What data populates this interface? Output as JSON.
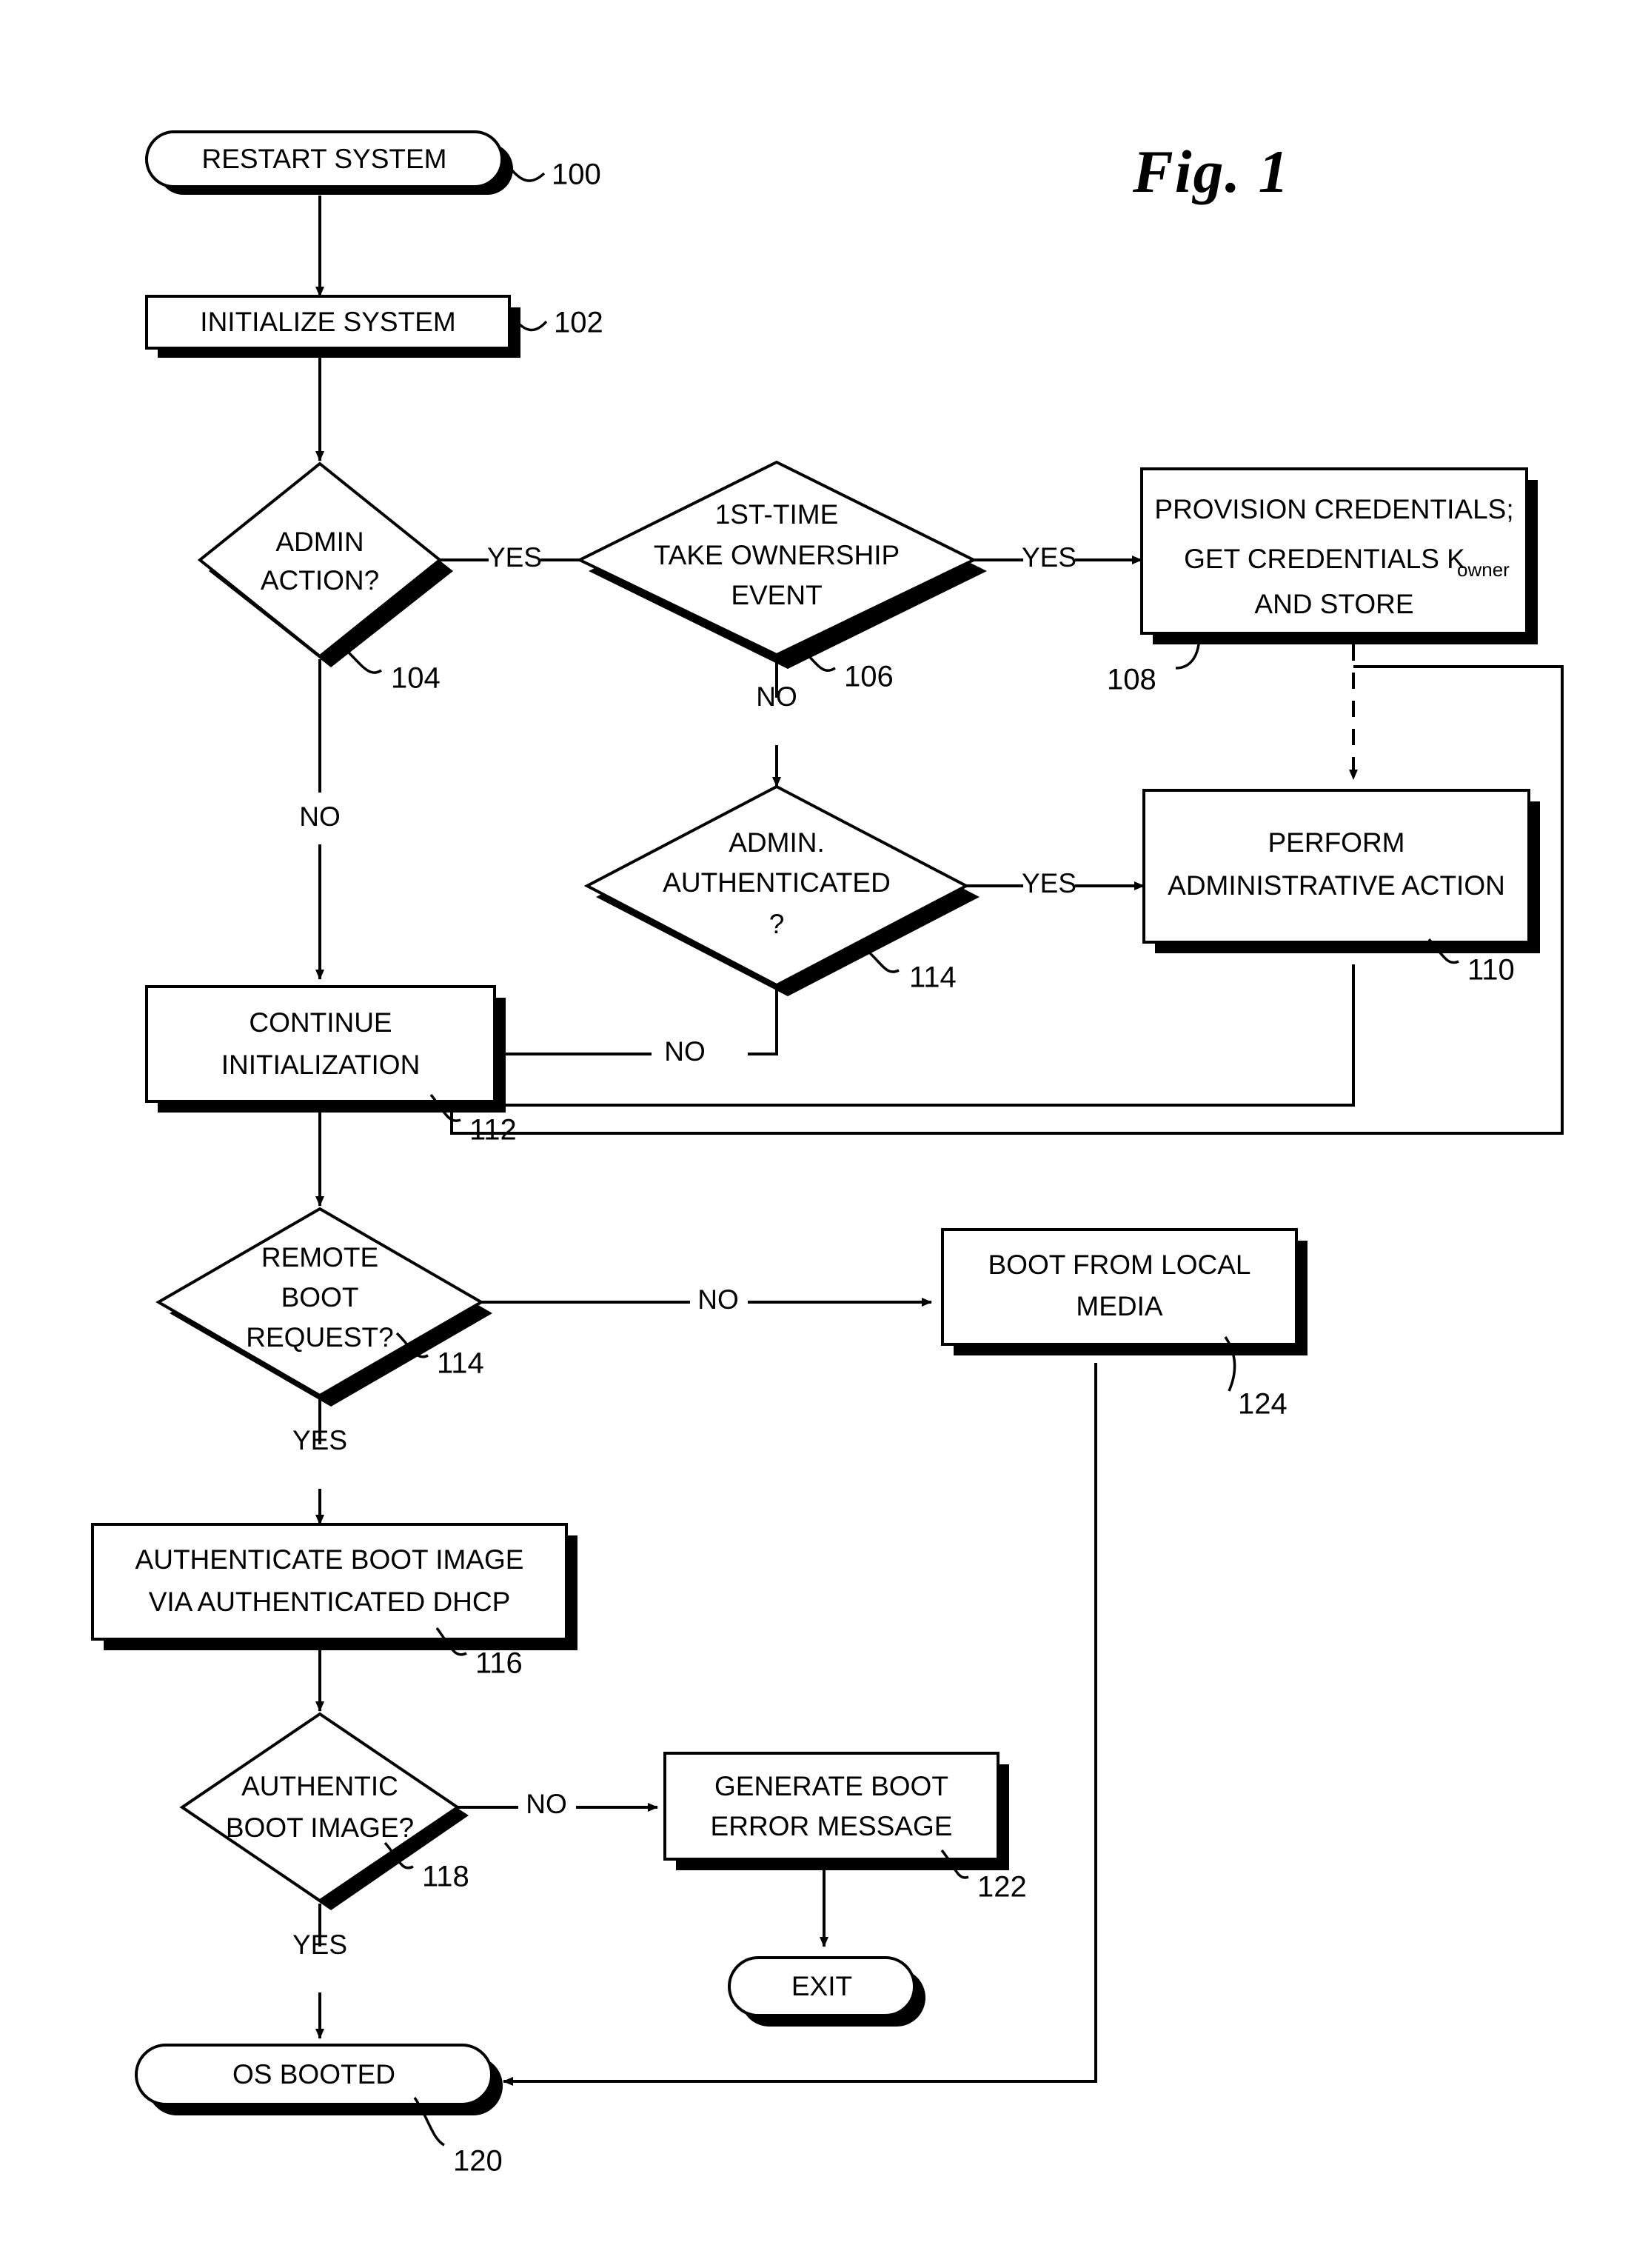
{
  "figure": {
    "label": "Fig. 1",
    "type": "patent-flowchart"
  },
  "nodes": {
    "n100": {
      "ref": "100",
      "shape": "terminal",
      "text": "RESTART SYSTEM"
    },
    "n102": {
      "ref": "102",
      "shape": "process",
      "text": "INITIALIZE SYSTEM"
    },
    "n104": {
      "ref": "104",
      "shape": "decision",
      "line1": "ADMIN",
      "line2": "ACTION?"
    },
    "n106": {
      "ref": "106",
      "shape": "decision",
      "line1": "1ST-TIME",
      "line2": "TAKE OWNERSHIP",
      "line3": "EVENT"
    },
    "n108": {
      "ref": "108",
      "shape": "process",
      "line1": "PROVISION CREDENTIALS;",
      "line2a": "GET CREDENTIALS K",
      "line2sub": "owner",
      "line3": "AND STORE"
    },
    "n110": {
      "ref": "110",
      "shape": "process",
      "line1": "PERFORM",
      "line2": "ADMINISTRATIVE ACTION"
    },
    "n114a": {
      "ref": "114",
      "shape": "decision",
      "line1": "ADMIN.",
      "line2": "AUTHENTICATED",
      "line3": "?"
    },
    "n112": {
      "ref": "112",
      "shape": "process",
      "line1": "CONTINUE",
      "line2": "INITIALIZATION"
    },
    "n114b": {
      "ref": "114",
      "shape": "decision",
      "line1": "REMOTE",
      "line2": "BOOT",
      "line3": "REQUEST?"
    },
    "n124": {
      "ref": "124",
      "shape": "process",
      "line1": "BOOT FROM LOCAL",
      "line2": "MEDIA"
    },
    "n116": {
      "ref": "116",
      "shape": "process",
      "line1": "AUTHENTICATE BOOT IMAGE",
      "line2": "VIA AUTHENTICATED DHCP"
    },
    "n118": {
      "ref": "118",
      "shape": "decision",
      "line1": "AUTHENTIC",
      "line2": "BOOT IMAGE?"
    },
    "n122": {
      "ref": "122",
      "shape": "process",
      "line1": "GENERATE BOOT",
      "line2": "ERROR MESSAGE"
    },
    "n126": {
      "ref": "",
      "shape": "terminal",
      "text": "EXIT"
    },
    "n120": {
      "ref": "120",
      "shape": "terminal",
      "text": "OS BOOTED"
    }
  },
  "edge_labels": {
    "e104_yes": "YES",
    "e104_no": "NO",
    "e106_yes": "YES",
    "e106_no": "NO",
    "e114a_yes": "YES",
    "e114a_no": "NO",
    "e114b_no": "NO",
    "e114b_yes": "YES",
    "e118_no": "NO",
    "e118_yes": "YES"
  },
  "colors": {
    "ink": "#000000",
    "paper": "#ffffff"
  },
  "chart_data": {
    "type": "flowchart",
    "title": "Fig. 1",
    "nodes": [
      {
        "id": "100",
        "label": "RESTART SYSTEM",
        "shape": "terminal"
      },
      {
        "id": "102",
        "label": "INITIALIZE SYSTEM",
        "shape": "process"
      },
      {
        "id": "104",
        "label": "ADMIN ACTION?",
        "shape": "decision"
      },
      {
        "id": "106",
        "label": "1ST-TIME TAKE OWNERSHIP EVENT",
        "shape": "decision"
      },
      {
        "id": "108",
        "label": "PROVISION CREDENTIALS; GET CREDENTIALS Kowner AND STORE",
        "shape": "process"
      },
      {
        "id": "110",
        "label": "PERFORM ADMINISTRATIVE ACTION",
        "shape": "process"
      },
      {
        "id": "114a",
        "label": "ADMIN. AUTHENTICATED ?",
        "shape": "decision"
      },
      {
        "id": "112",
        "label": "CONTINUE INITIALIZATION",
        "shape": "process"
      },
      {
        "id": "114b",
        "label": "REMOTE BOOT REQUEST?",
        "shape": "decision"
      },
      {
        "id": "124",
        "label": "BOOT FROM LOCAL MEDIA",
        "shape": "process"
      },
      {
        "id": "116",
        "label": "AUTHENTICATE BOOT IMAGE VIA AUTHENTICATED DHCP",
        "shape": "process"
      },
      {
        "id": "118",
        "label": "AUTHENTIC BOOT IMAGE?",
        "shape": "decision"
      },
      {
        "id": "122",
        "label": "GENERATE BOOT ERROR MESSAGE",
        "shape": "process"
      },
      {
        "id": "126",
        "label": "EXIT",
        "shape": "terminal"
      },
      {
        "id": "120",
        "label": "OS BOOTED",
        "shape": "terminal"
      }
    ],
    "edges": [
      {
        "from": "100",
        "to": "102",
        "label": ""
      },
      {
        "from": "102",
        "to": "104",
        "label": ""
      },
      {
        "from": "104",
        "to": "106",
        "label": "YES"
      },
      {
        "from": "104",
        "to": "112",
        "label": "NO"
      },
      {
        "from": "106",
        "to": "108",
        "label": "YES"
      },
      {
        "from": "106",
        "to": "114a",
        "label": "NO"
      },
      {
        "from": "108",
        "to": "110",
        "label": "",
        "style": "dashed"
      },
      {
        "from": "108",
        "to": "112",
        "label": ""
      },
      {
        "from": "114a",
        "to": "110",
        "label": "YES"
      },
      {
        "from": "114a",
        "to": "112",
        "label": "NO"
      },
      {
        "from": "110",
        "to": "112",
        "label": ""
      },
      {
        "from": "112",
        "to": "114b",
        "label": ""
      },
      {
        "from": "114b",
        "to": "124",
        "label": "NO"
      },
      {
        "from": "114b",
        "to": "116",
        "label": "YES"
      },
      {
        "from": "116",
        "to": "118",
        "label": ""
      },
      {
        "from": "118",
        "to": "122",
        "label": "NO"
      },
      {
        "from": "118",
        "to": "120",
        "label": "YES"
      },
      {
        "from": "122",
        "to": "126",
        "label": ""
      },
      {
        "from": "124",
        "to": "120",
        "label": ""
      }
    ]
  }
}
